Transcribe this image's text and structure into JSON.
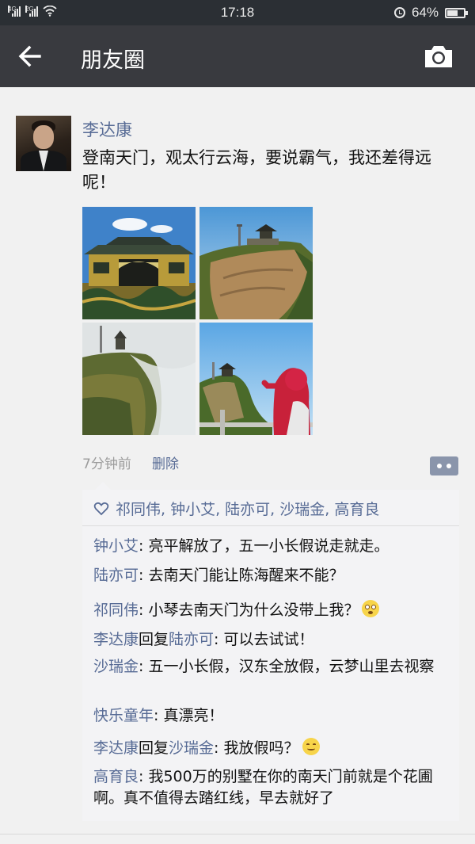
{
  "status_bar": {
    "signal1_label": "4G",
    "signal2_label": "2G",
    "time": "17:18",
    "battery": "64%",
    "battery_level": 0.64
  },
  "header": {
    "title": "朋友圈",
    "back_icon": "arrow-left-icon",
    "camera_icon": "camera-icon"
  },
  "post": {
    "author": "李达康",
    "text": "登南天门，观太行云海，要说霸气，我还差得远呢！",
    "photos": [
      "ornate-gate-photo",
      "cliff-pavilion-photo",
      "misty-mountain-photo",
      "woman-on-cliff-photo"
    ],
    "time": "7分钟前",
    "delete_label": "删除"
  },
  "likes": {
    "names": "祁同伟, 钟小艾, 陆亦可, 沙瑞金, 高育良"
  },
  "comments": [
    {
      "name": "钟小艾",
      "sep": ": ",
      "text": "亮平解放了，五一小长假说走就走。"
    },
    {
      "name": "陆亦可",
      "sep": ": ",
      "text": "去南天门能让陈海醒来不能？"
    },
    {
      "name": "祁同伟",
      "sep": ": ",
      "text": "小琴去南天门为什么没带上我？",
      "emoji": "shocked-emoji"
    },
    {
      "name": "李达康",
      "reply_word": "回复",
      "reply_to": "陆亦可",
      "sep": ": ",
      "text": "可以去试试！"
    },
    {
      "name": "沙瑞金",
      "sep": ": ",
      "text": "五一小长假，汉东全放假，云梦山里去视察"
    },
    {
      "name": "快乐童年",
      "sep": ": ",
      "text": "真漂亮！"
    },
    {
      "name": "李达康",
      "reply_word": "回复",
      "reply_to": "沙瑞金",
      "sep": ": ",
      "text": "我放假吗？",
      "emoji": "smile-emoji"
    },
    {
      "name": "高育良",
      "sep": ": ",
      "text": "我500万的别墅在你的南天门前就是个花圃啊。真不值得去踏红线，早去就好了"
    }
  ],
  "colors": {
    "name_link": "#576b95",
    "title_bar": "#393a3f",
    "status_bar": "#2b2f34",
    "background": "#f1f1f1"
  }
}
